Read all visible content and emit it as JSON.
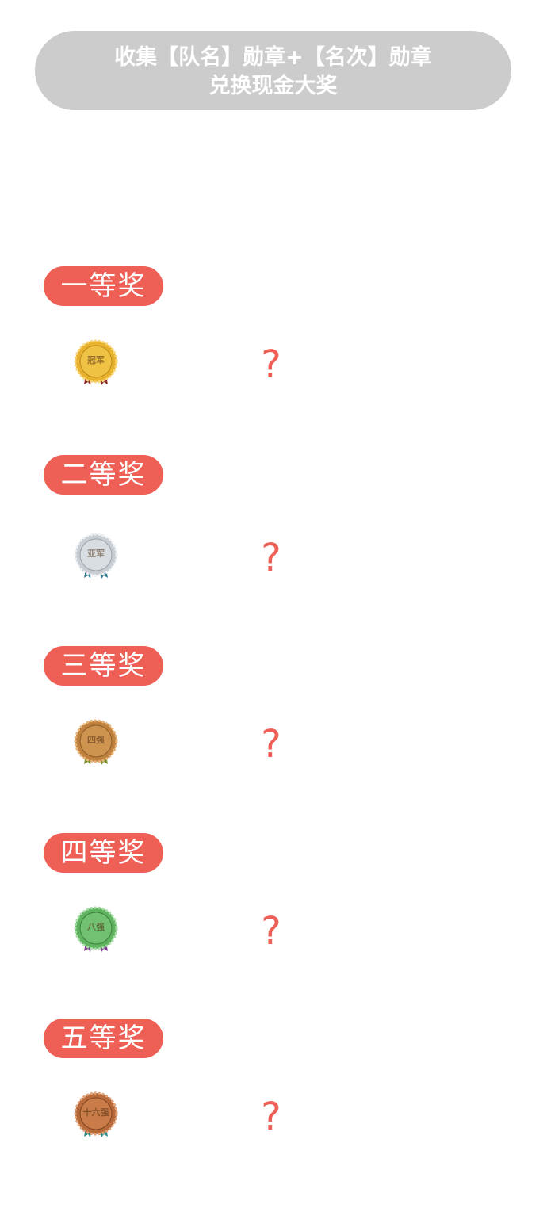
{
  "header": {
    "line1": "收集【队名】勋章+【名次】勋章",
    "line2": "兑换现金大奖"
  },
  "tiers": [
    {
      "label": "一等奖",
      "medal": {
        "text": "冠军",
        "icon": "gold-champion-medal-icon",
        "color": "#e8b22c",
        "ribbon": "#8b2a2a"
      },
      "mystery": "?"
    },
    {
      "label": "二等奖",
      "medal": {
        "text": "亚军",
        "icon": "silver-runner-up-medal-icon",
        "color": "#c7cdd3",
        "ribbon": "#2f7d8f"
      },
      "mystery": "?"
    },
    {
      "label": "三等奖",
      "medal": {
        "text": "四强",
        "icon": "bronze-top4-medal-icon",
        "color": "#c0813e",
        "ribbon": "#7a8f2e"
      },
      "mystery": "?"
    },
    {
      "label": "四等奖",
      "medal": {
        "text": "八强",
        "icon": "green-top8-medal-icon",
        "color": "#5fb35f",
        "ribbon": "#7a3a8f"
      },
      "mystery": "?"
    },
    {
      "label": "五等奖",
      "medal": {
        "text": "十六强",
        "icon": "copper-top16-medal-icon",
        "color": "#b86a3a",
        "ribbon": "#2e8f86"
      },
      "mystery": "?"
    }
  ],
  "colors": {
    "accent": "#ee5f55",
    "header_bg": "#cccccc"
  }
}
